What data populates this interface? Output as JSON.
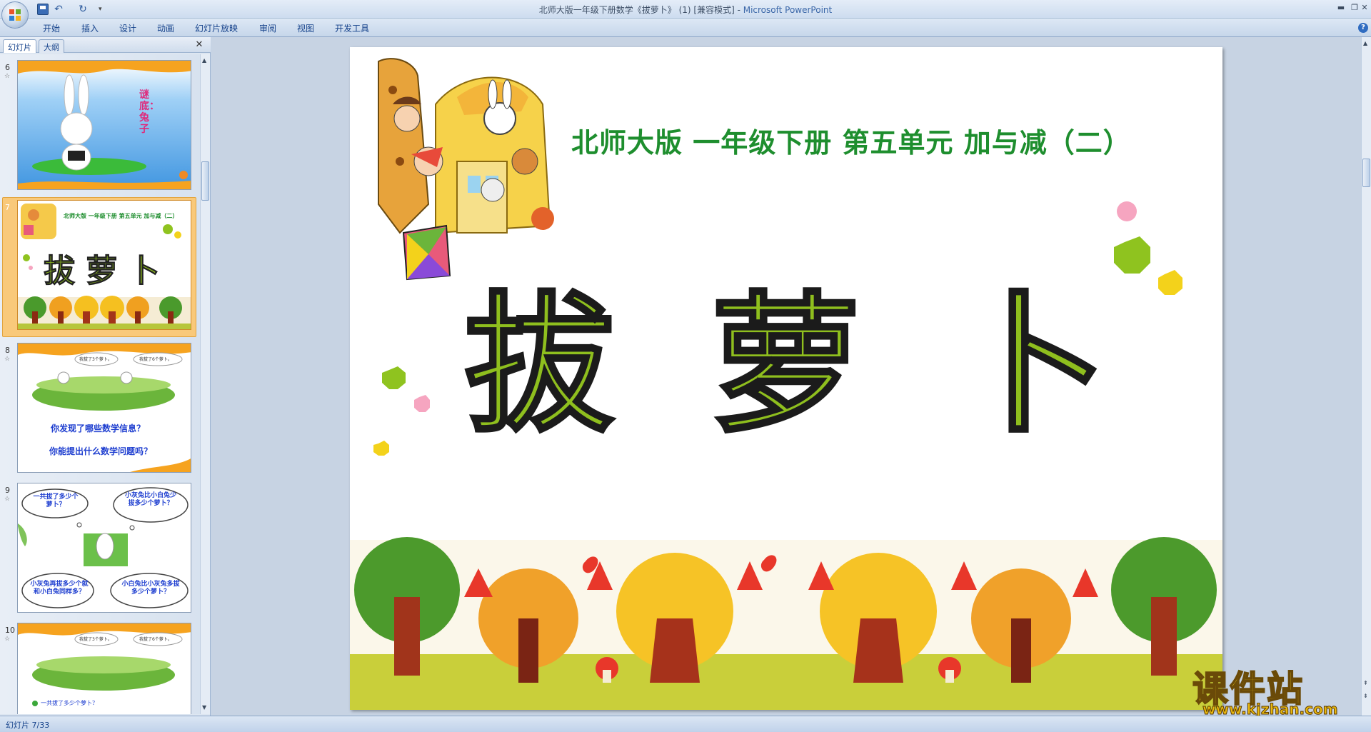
{
  "window": {
    "title_doc": "北师大版一年级下册数学《拔萝卜》 (1) [兼容模式] - ",
    "title_app": "Microsoft PowerPoint"
  },
  "ribbon": {
    "tabs": [
      "开始",
      "插入",
      "设计",
      "动画",
      "幻灯片放映",
      "审阅",
      "视图",
      "开发工具"
    ]
  },
  "panel": {
    "tab_slides": "幻灯片",
    "tab_outline": "大纲",
    "thumbnails": [
      {
        "num": "6",
        "riddle": "谜底：兔子"
      },
      {
        "num": "7",
        "heading": "北师大版  一年级下册  第五单元  加与减（二）",
        "title": "拔 萝 卜"
      },
      {
        "num": "8",
        "q1": "你发现了哪些数学信息？",
        "q2": "你能提出什么数学问题吗？",
        "bubble1": "我拔了3个萝卜。",
        "bubble2": "我拔了6个萝卜。"
      },
      {
        "num": "9",
        "b1": "一共拔了多少个萝卜？",
        "b2": "小灰兔比小白兔少拔多少个萝卜？",
        "b3": "小灰兔再拔多少个就和小白兔同样多？",
        "b4": "小白兔比小灰兔多拔多少个萝卜？"
      },
      {
        "num": "10",
        "bubble1": "我拔了3个萝卜。",
        "bubble2": "我拔了6个萝卜。",
        "caption": "一共拔了多少个萝卜？"
      }
    ]
  },
  "slide": {
    "subtitle": "北师大版  一年级下册  第五单元  加与减（二）",
    "title_chars": [
      "拔",
      "萝",
      "卜"
    ]
  },
  "status": {
    "text": "幻灯片 7/33"
  },
  "watermark": {
    "cn": "课件站",
    "url": "www.kjzhan.com"
  }
}
